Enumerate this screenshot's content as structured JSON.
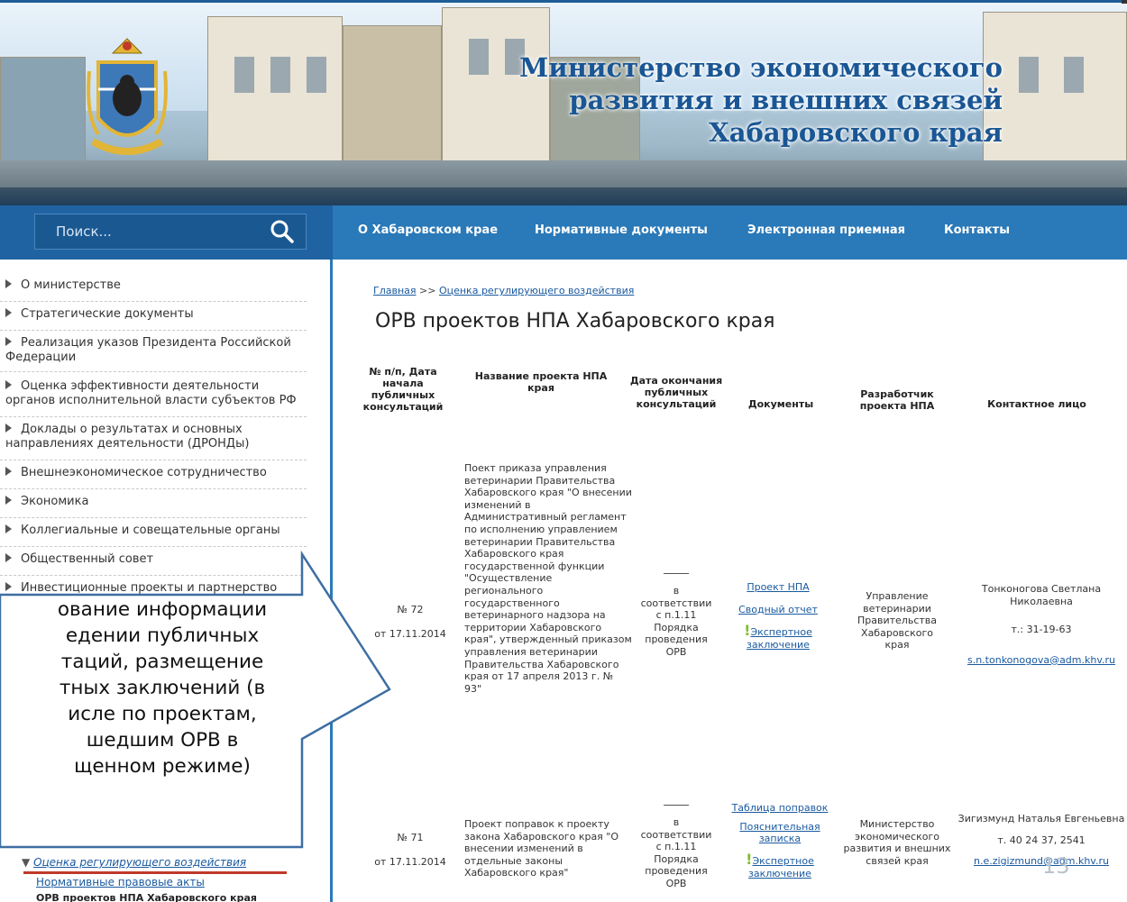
{
  "header": {
    "title_lines": [
      "Министерство экономического",
      "развития и внешних связей",
      "Хабаровского края"
    ]
  },
  "search": {
    "placeholder": "Поиск..."
  },
  "nav": [
    "О Хабаровском крае",
    "Нормативные документы",
    "Электронная приемная",
    "Контакты"
  ],
  "sidebar": {
    "items": [
      "О министерстве",
      "Стратегические документы",
      "Реализация указов Президента Российской Федерации",
      "Оценка эффективности деятельности органов исполнительной власти субъектов РФ",
      "Доклады о результатах и основных направлениях деятельности (ДРОНДы)",
      "Внешнеэкономическое сотрудничество",
      "Экономика",
      "Коллегиальные и совещательные органы",
      "Общественный совет",
      "Инвестиционные проекты и партнерство"
    ],
    "active_section": "Оценка регулирующего воздействия",
    "sub_items": [
      "Нормативные правовые акты",
      "ОРВ проектов НПА Хабаровского края"
    ]
  },
  "breadcrumb": {
    "home": "Главная",
    "sep": " >> ",
    "current": "Оценка регулирующего воздействия"
  },
  "page_title": "ОРВ проектов НПА Хабаровского края",
  "table": {
    "headers": [
      "№ п/п, Дата начала публичных консультаций",
      "Название проекта НПА края",
      "Дата окончания публичных консультаций",
      "Документы",
      "Разработчик проекта НПА",
      "Контактное лицо"
    ],
    "rows": [
      {
        "num": "№ 72",
        "date": "от 17.11.2014",
        "name": "Поект приказа управления ветеринарии Правительства Хабаровского края \"О внесении изменений в Административный регламент по исполнению управлением ветеринарии Правительства Хабаровского края государственной функции \"Осуществление регионального государственного ветеринарного надзора на территории Хабаровского края\", утвержденный приказом управления ветеринарии Правительства Хабаровского края от 17 апреля 2013 г. № 93\"",
        "end_date": "в соответствии с п.1.11 Порядка проведения ОРВ",
        "docs": [
          "Проект НПА",
          "Сводный отчет",
          "Экспертное заключение"
        ],
        "developer": "Управление ветеринарии Правительства Хабаровского края",
        "contact_name": "Тонконогова Светлана Николаевна",
        "contact_phone": "т.: 31-19-63",
        "contact_email": "s.n.tonkonogova@adm.khv.ru"
      },
      {
        "num": "№ 71",
        "date": "от 17.11.2014",
        "name": "Проект поправок к проекту закона Хабаровского края \"О внесении изменений в отдельные законы Хабаровского края\"",
        "end_date": "в соответствии с п.1.11 Порядка проведения ОРВ",
        "docs": [
          "Таблица поправок",
          "Пояснительная записка",
          "Экспертное заключение"
        ],
        "developer": "Министерство экономического развития и внешних связей края",
        "contact_name": "Зигизмунд Наталья Евгеньевна",
        "contact_phone": "т. 40 24 37, 2541",
        "contact_email": "n.e.zigizmund@adm.khv.ru"
      }
    ]
  },
  "callout": {
    "lines": [
      "ование информации",
      "едении публичных",
      "таций, размещение",
      "тных заключений (в",
      "исле по проектам,",
      "шедшим ОРВ в",
      "щенном режиме)"
    ]
  },
  "slide_number": "13",
  "colors": {
    "brand_blue": "#1f63a3",
    "nav_blue": "#2a79b8",
    "link": "#1a5aa0",
    "accent_red": "#c0392b"
  }
}
